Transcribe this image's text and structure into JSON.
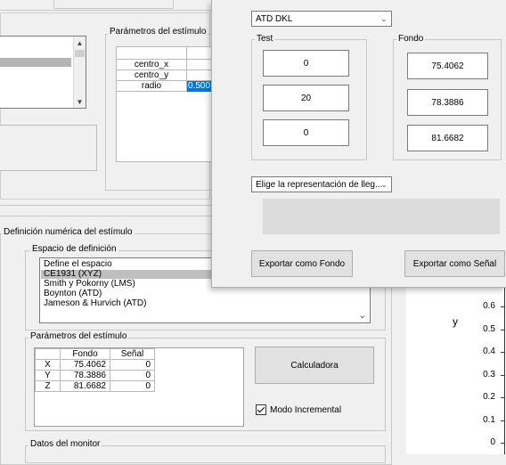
{
  "top_panel": {
    "stimulus_params_title": "Parámetros del estímulo",
    "param_rows": [
      {
        "name": "centro_x",
        "value": ""
      },
      {
        "name": "centro_y",
        "value": ""
      },
      {
        "name": "radio",
        "value": "0.500"
      }
    ]
  },
  "numeric_definition": {
    "title": "Definición numérica del estímulo",
    "space_title": "Espacio de definición",
    "spaces": [
      "Define el espacio",
      "CE1931 (XYZ)",
      "Smith y Pokorny (LMS)",
      "Boynton (ATD)",
      "Jameson & Hurvich (ATD)"
    ],
    "selected_index": 1,
    "params_title": "Parámetros del estímulo",
    "table_headers": [
      "",
      "Fondo",
      "Señal"
    ],
    "table_rows": [
      {
        "label": "X",
        "fondo": "75.4062",
        "senal": "0"
      },
      {
        "label": "Y",
        "fondo": "78.3886",
        "senal": "0"
      },
      {
        "label": "Z",
        "fondo": "81.6682",
        "senal": "0"
      }
    ],
    "calc_button": "Calculadora",
    "incremental_label": "Modo Incremental",
    "incremental_checked": true,
    "monitor_title": "Datos del monitor"
  },
  "plot": {
    "y_label": "y",
    "y_ticks": [
      "0",
      "0.1",
      "0.2",
      "0.3",
      "0.4",
      "0.5",
      "0.6"
    ]
  },
  "popup": {
    "space_select": "ATD DKL",
    "test_title": "Test",
    "test_values": [
      "0",
      "20",
      "0"
    ],
    "fondo_title": "Fondo",
    "fondo_values": [
      "75.4062",
      "78.3886",
      "81.6682"
    ],
    "representation_select": "Elige la representación de lleg...",
    "export_fondo": "Exportar como Fondo",
    "export_senal": "Exportar como Señal"
  }
}
